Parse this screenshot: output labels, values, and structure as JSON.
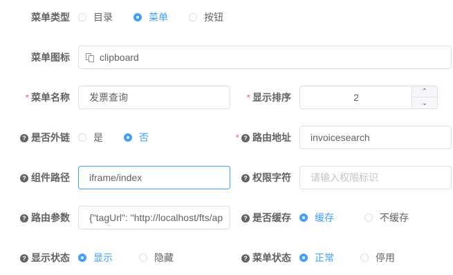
{
  "menu_type": {
    "label": "菜单类型",
    "options": [
      "目录",
      "菜单",
      "按钮"
    ],
    "selected": "菜单"
  },
  "menu_icon": {
    "label": "菜单图标",
    "value": "clipboard"
  },
  "menu_name": {
    "label": "菜单名称",
    "value": "发票查询"
  },
  "display_order": {
    "label": "显示排序",
    "value": "2"
  },
  "is_external": {
    "label": "是否外链",
    "options": [
      "是",
      "否"
    ],
    "selected": "否"
  },
  "route_path": {
    "label": "路由地址",
    "value": "invoicesearch"
  },
  "component_path": {
    "label": "组件路径",
    "value": "iframe/index"
  },
  "permission": {
    "label": "权限字符",
    "placeholder": "请输入权限标识"
  },
  "route_params": {
    "label": "路由参数",
    "value": "{\"tagUrl\": \"http://localhost/fts/ap"
  },
  "is_cache": {
    "label": "是否缓存",
    "options": [
      "缓存",
      "不缓存"
    ],
    "selected": "缓存"
  },
  "visible": {
    "label": "显示状态",
    "options": [
      "显示",
      "隐藏"
    ],
    "selected": "显示"
  },
  "status": {
    "label": "菜单状态",
    "options": [
      "正常",
      "停用"
    ],
    "selected": "正常"
  },
  "colors": {
    "accent": "#409eff",
    "required": "#f56c6c",
    "border": "#dcdfe6"
  }
}
